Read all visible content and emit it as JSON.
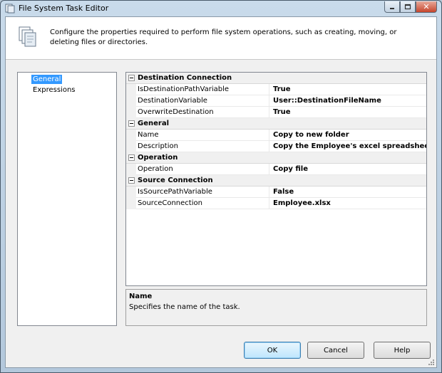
{
  "window": {
    "title": "File System Task Editor"
  },
  "header": {
    "description": "Configure the properties required to perform file system operations, such as creating, moving, or deleting files or directories."
  },
  "nav": {
    "items": [
      {
        "label": "General",
        "selected": true
      },
      {
        "label": "Expressions",
        "selected": false
      }
    ]
  },
  "grid": {
    "categories": [
      {
        "label": "Destination Connection",
        "properties": [
          {
            "name": "IsDestinationPathVariable",
            "value": "True"
          },
          {
            "name": "DestinationVariable",
            "value": "User::DestinationFileName"
          },
          {
            "name": "OverwriteDestination",
            "value": "True"
          }
        ]
      },
      {
        "label": "General",
        "properties": [
          {
            "name": "Name",
            "value": "Copy to new folder"
          },
          {
            "name": "Description",
            "value": "Copy the Employee's excel spreadsheet to d:\\D"
          }
        ]
      },
      {
        "label": "Operation",
        "properties": [
          {
            "name": "Operation",
            "value": "Copy file"
          }
        ]
      },
      {
        "label": "Source Connection",
        "properties": [
          {
            "name": "IsSourcePathVariable",
            "value": "False"
          },
          {
            "name": "SourceConnection",
            "value": "Employee.xlsx"
          }
        ]
      }
    ]
  },
  "help": {
    "title": "Name",
    "text": "Specifies the name of the task."
  },
  "buttons": {
    "ok": "OK",
    "cancel": "Cancel",
    "help": "Help"
  },
  "colors": {
    "selection": "#3399ff",
    "close_button": "#c6452c"
  }
}
